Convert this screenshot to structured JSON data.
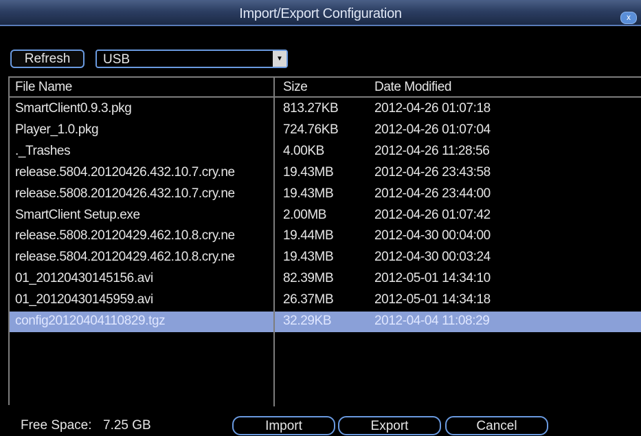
{
  "window": {
    "title": "Import/Export Configuration",
    "close_glyph": "x",
    "close_icon": "close-icon"
  },
  "toolbar": {
    "refresh_label": "Refresh",
    "device_value": "USB",
    "dropdown_glyph": "▼",
    "dropdown_icon": "chevron-down-icon"
  },
  "table": {
    "columns": [
      "File Name",
      "Size",
      "Date Modified"
    ],
    "selected_index": 10,
    "rows": [
      {
        "name": "SmartClient0.9.3.pkg",
        "size": "813.27KB",
        "date": "2012-04-26 01:07:18"
      },
      {
        "name": "Player_1.0.pkg",
        "size": "724.76KB",
        "date": "2012-04-26 01:07:04"
      },
      {
        "name": "._Trashes",
        "size": "4.00KB",
        "date": "2012-04-26 11:28:56"
      },
      {
        "name": "release.5804.20120426.432.10.7.cry.ne",
        "size": "19.43MB",
        "date": "2012-04-26 23:43:58"
      },
      {
        "name": "release.5808.20120426.432.10.7.cry.ne",
        "size": "19.43MB",
        "date": "2012-04-26 23:44:00"
      },
      {
        "name": "SmartClient Setup.exe",
        "size": "2.00MB",
        "date": "2012-04-26 01:07:42"
      },
      {
        "name": "release.5808.20120429.462.10.8.cry.ne",
        "size": "19.44MB",
        "date": "2012-04-30 00:04:00"
      },
      {
        "name": "release.5804.20120429.462.10.8.cry.ne",
        "size": "19.43MB",
        "date": "2012-04-30 00:03:24"
      },
      {
        "name": "01_20120430145156.avi",
        "size": "82.39MB",
        "date": "2012-05-01 14:34:10"
      },
      {
        "name": "01_20120430145959.avi",
        "size": "26.37MB",
        "date": "2012-05-01 14:34:18"
      },
      {
        "name": "config20120404110829.tgz",
        "size": "32.29KB",
        "date": "2012-04-04 11:08:29"
      }
    ]
  },
  "footer": {
    "free_space_label": "Free Space:",
    "free_space_value": "7.25 GB",
    "import_label": "Import",
    "export_label": "Export",
    "cancel_label": "Cancel"
  },
  "colors": {
    "title_bar": "#2c3e62",
    "accent_border": "#6a9ae0",
    "selection": "#8aa0d8",
    "background": "#000000"
  }
}
